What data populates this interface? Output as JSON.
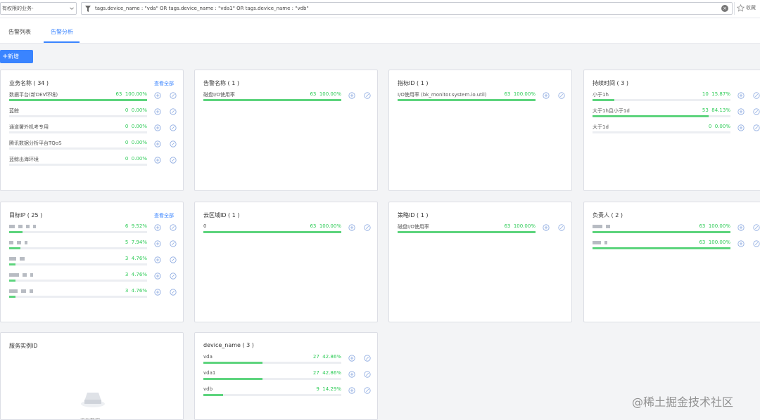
{
  "topbar": {
    "business_select": "有权限的业务-",
    "query": "tags.device_name : \"vda\" OR tags.device_name : \"vda1\" OR tags.device_name : \"vdb\"",
    "favorite_label": "收藏"
  },
  "tabs": [
    "告警列表",
    "告警分析"
  ],
  "add_button": "新增",
  "cards": {
    "business": {
      "title": "业务名称 ( 34 )",
      "view_all": "查看全部",
      "rows": [
        {
          "label": "数据平台(新DEV环境)",
          "count": "63",
          "pct": "100.00%",
          "ratio": 1.0
        },
        {
          "label": "蓝鲸",
          "count": "0",
          "pct": "0.00%",
          "ratio": 0
        },
        {
          "label": "通道署外机考专用",
          "count": "0",
          "pct": "0.00%",
          "ratio": 0
        },
        {
          "label": "腾讯数据分析平台TQoS",
          "count": "0",
          "pct": "0.00%",
          "ratio": 0
        },
        {
          "label": "蓝鲸出海环境",
          "count": "0",
          "pct": "0.00%",
          "ratio": 0
        }
      ]
    },
    "alert_name": {
      "title": "告警名称 ( 1 )",
      "rows": [
        {
          "label": "磁盘I/O使用率",
          "count": "63",
          "pct": "100.00%",
          "ratio": 1.0
        }
      ]
    },
    "metric_id": {
      "title": "指标ID ( 1 )",
      "rows": [
        {
          "label": "I/O使用率 (bk_monitor.system.io.util)",
          "count": "63",
          "pct": "100.00%",
          "ratio": 1.0
        }
      ]
    },
    "duration": {
      "title": "持续时间 ( 3 )",
      "rows": [
        {
          "label": "小于1h",
          "count": "10",
          "pct": "15.87%",
          "ratio": 0.1587
        },
        {
          "label": "大于1h且小于1d",
          "count": "53",
          "pct": "84.13%",
          "ratio": 0.8413
        },
        {
          "label": "大于1d",
          "count": "0",
          "pct": "0.00%",
          "ratio": 0
        }
      ]
    },
    "target_ip": {
      "title": "目标IP ( 25 )",
      "view_all": "查看全部",
      "rows": [
        {
          "count": "6",
          "pct": "9.52%",
          "ratio": 0.0952
        },
        {
          "count": "5",
          "pct": "7.94%",
          "ratio": 0.0794
        },
        {
          "count": "3",
          "pct": "4.76%",
          "ratio": 0.0476
        },
        {
          "count": "3",
          "pct": "4.76%",
          "ratio": 0.0476
        },
        {
          "count": "3",
          "pct": "4.76%",
          "ratio": 0.0476
        }
      ]
    },
    "cloud_area": {
      "title": "云区域ID ( 1 )",
      "rows": [
        {
          "label": "0",
          "count": "63",
          "pct": "100.00%",
          "ratio": 1.0
        }
      ]
    },
    "strategy_id": {
      "title": "策略ID ( 1 )",
      "rows": [
        {
          "label": "磁盘I/O使用率",
          "count": "63",
          "pct": "100.00%",
          "ratio": 1.0
        }
      ]
    },
    "owner": {
      "title": "负责人 ( 2 )",
      "rows": [
        {
          "count": "63",
          "pct": "100.00%",
          "ratio": 1.0
        },
        {
          "count": "63",
          "pct": "100.00%",
          "ratio": 1.0
        }
      ]
    },
    "service_instance": {
      "title": "服务实例ID",
      "empty_text": "没有数据"
    },
    "device_name": {
      "title": "device_name ( 3 )",
      "rows": [
        {
          "label": "vda",
          "count": "27",
          "pct": "42.86%",
          "ratio": 0.4286
        },
        {
          "label": "vda1",
          "count": "27",
          "pct": "42.86%",
          "ratio": 0.4286
        },
        {
          "label": "vdb",
          "count": "9",
          "pct": "14.29%",
          "ratio": 0.1429
        }
      ]
    }
  },
  "watermark": "@稀土掘金技术社区",
  "colors": {
    "accent": "#3a84ff",
    "success": "#2dcb56"
  }
}
